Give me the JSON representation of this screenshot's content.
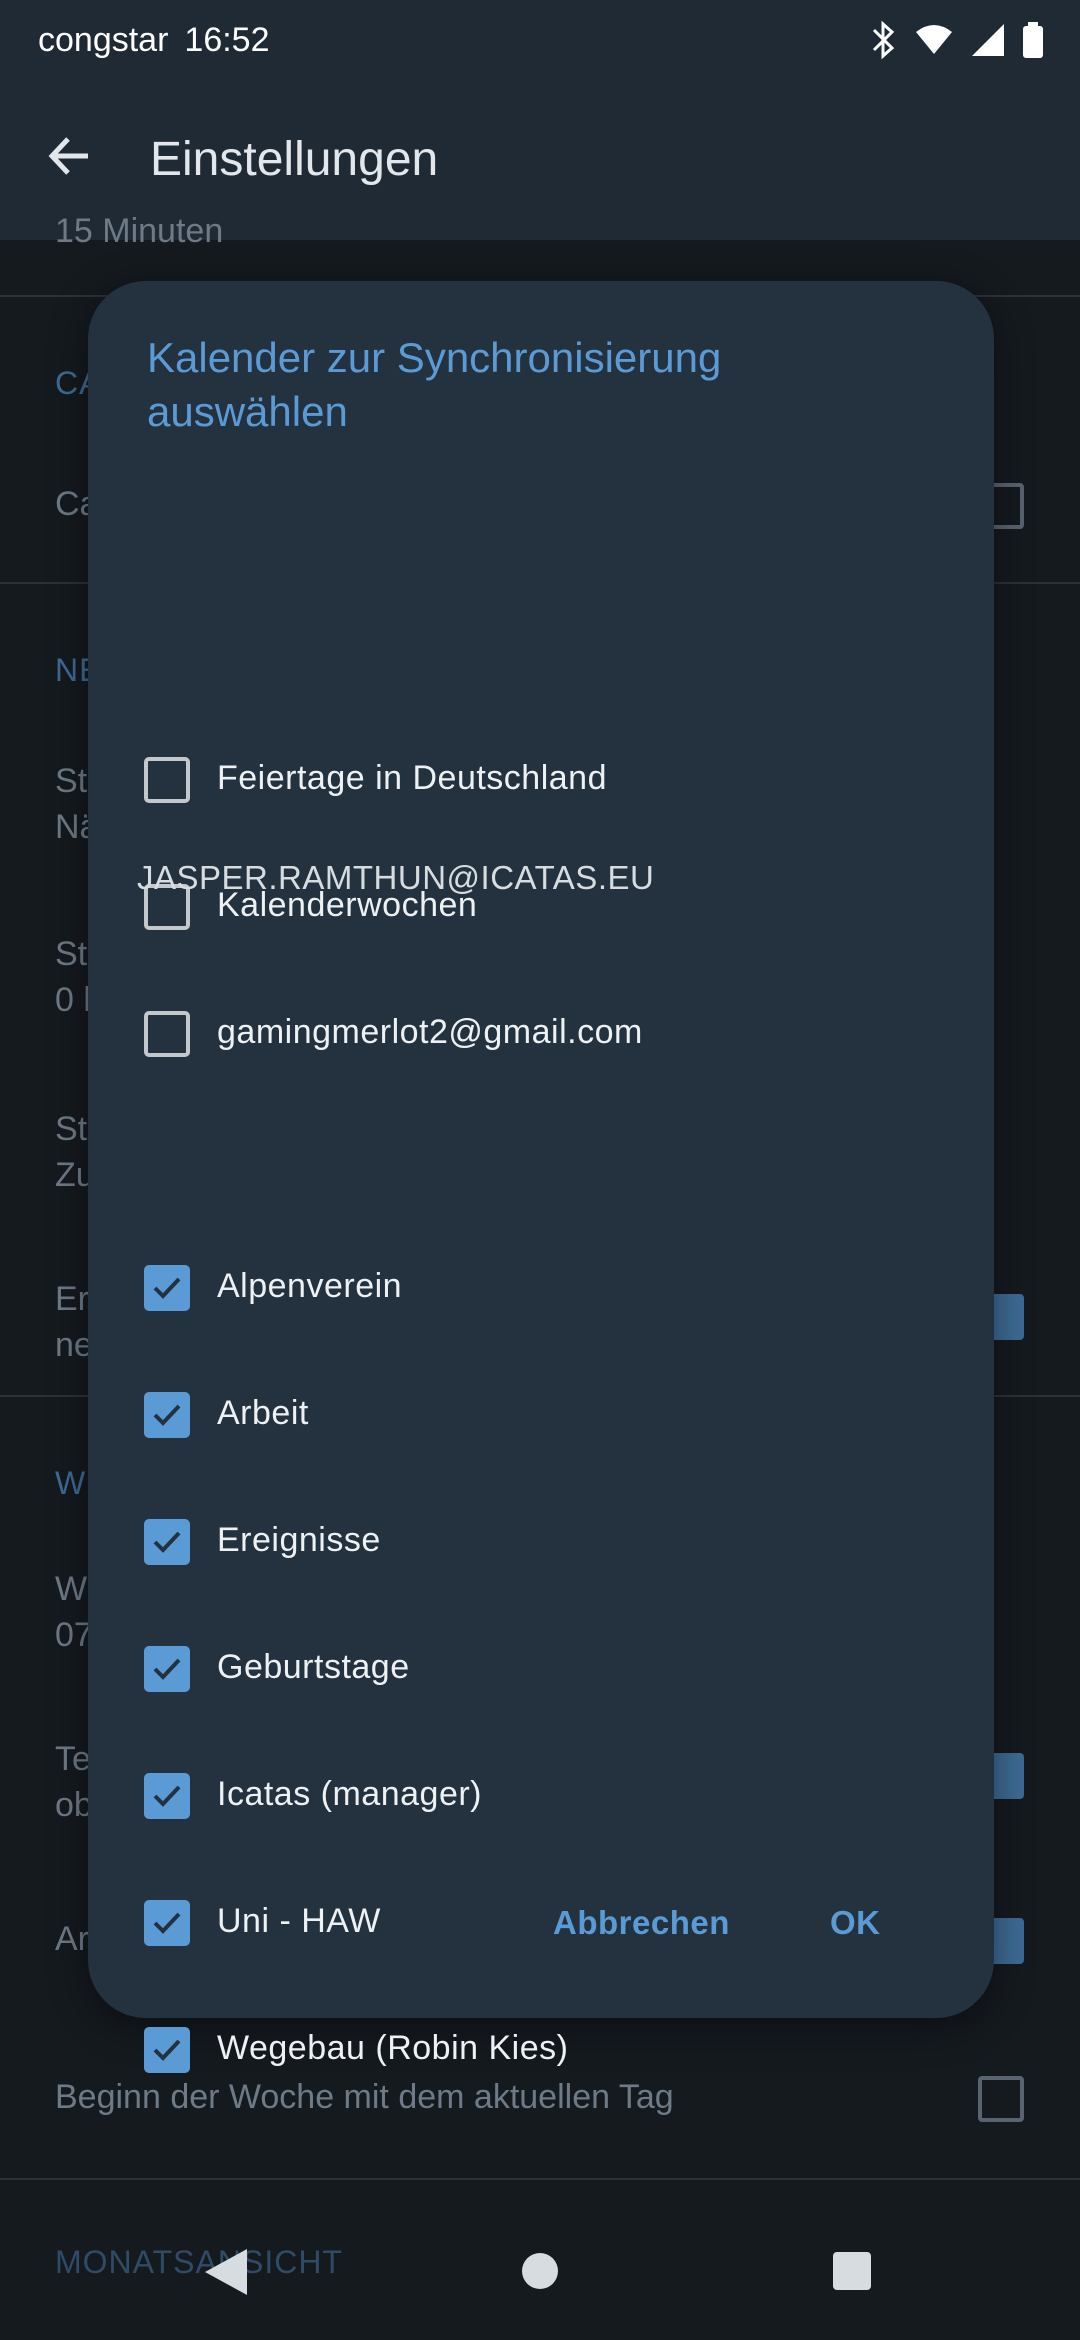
{
  "status": {
    "carrier": "congstar",
    "time": "16:52"
  },
  "appbar": {
    "title": "Einstellungen"
  },
  "background": {
    "top_partial": "15 Minuten",
    "sec1": "CA",
    "row1": "Ca",
    "sec2": "NE",
    "row2a": "St",
    "row2b": "Nä",
    "row3a": "St",
    "row3b": "0 l",
    "row4a": "St",
    "row4b": "Zu",
    "row5a": "Er",
    "row5b": "ne",
    "sec3": "W",
    "row6a": "W",
    "row6b": "07",
    "row7a": "Te",
    "row7b": "ob",
    "row8": "Ar",
    "week_start": "Beginn der Woche mit dem aktuellen Tag",
    "month_section": "MONATSANSICHT"
  },
  "dialog": {
    "title": "Kalender zur Synchronisierung auswählen",
    "items_top": [
      {
        "label": "Feiertage in Deutschland",
        "checked": false
      },
      {
        "label": "Kalenderwochen",
        "checked": false
      },
      {
        "label": "gamingmerlot2@gmail.com",
        "checked": false
      }
    ],
    "group_header": "JASPER.RAMTHUN@ICATAS.EU",
    "items_group": [
      {
        "label": "Alpenverein",
        "checked": true
      },
      {
        "label": "Arbeit",
        "checked": true
      },
      {
        "label": "Ereignisse",
        "checked": true
      },
      {
        "label": "Geburtstage",
        "checked": true
      },
      {
        "label": "Icatas (manager)",
        "checked": true
      },
      {
        "label": "Uni - HAW",
        "checked": true
      },
      {
        "label": "Wegebau (Robin Kies)",
        "checked": true
      }
    ],
    "cancel_label": "Abbrechen",
    "ok_label": "OK"
  }
}
